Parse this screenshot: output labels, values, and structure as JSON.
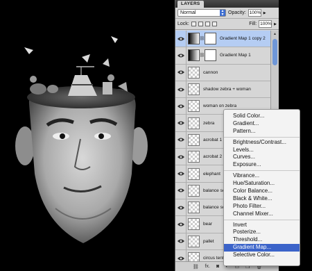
{
  "panel": {
    "tab": "LAYERS",
    "blend_mode": "Normal",
    "opacity_label": "Opacity:",
    "opacity_value": "100%",
    "lock_label": "Lock:",
    "fill_label": "Fill:",
    "fill_value": "100%"
  },
  "layers": [
    {
      "name": "Gradient Map 1 copy 2",
      "type": "adjustment",
      "selected": true
    },
    {
      "name": "Gradient Map 1",
      "type": "adjustment",
      "selected": false
    },
    {
      "name": "cannon",
      "type": "pixel",
      "selected": false
    },
    {
      "name": "shadow zebra + woman",
      "type": "pixel",
      "selected": false
    },
    {
      "name": "woman on zebra",
      "type": "pixel",
      "selected": false
    },
    {
      "name": "zebra",
      "type": "pixel",
      "selected": false
    },
    {
      "name": "acrobat 1",
      "type": "pixel",
      "selected": false
    },
    {
      "name": "acrobat 2",
      "type": "pixel",
      "selected": false
    },
    {
      "name": "elephant",
      "type": "pixel",
      "selected": false
    },
    {
      "name": "balance scale",
      "type": "pixel",
      "selected": false
    },
    {
      "name": "balance scale",
      "type": "pixel",
      "selected": false
    },
    {
      "name": "bear",
      "type": "pixel",
      "selected": false
    },
    {
      "name": "pallet",
      "type": "pixel",
      "selected": false
    },
    {
      "name": "circus tent",
      "type": "pixel",
      "selected": false
    }
  ],
  "menu": {
    "groups": [
      [
        "Solid Color...",
        "Gradient...",
        "Pattern..."
      ],
      [
        "Brightness/Contrast...",
        "Levels...",
        "Curves...",
        "Exposure..."
      ],
      [
        "Vibrance...",
        "Hue/Saturation...",
        "Color Balance...",
        "Black & White...",
        "Photo Filter...",
        "Channel Mixer..."
      ],
      [
        "Invert",
        "Posterize...",
        "Threshold...",
        "Gradient Map...",
        "Selective Color..."
      ]
    ],
    "highlighted": "Gradient Map...",
    "highlight_color": "#3b63c9"
  },
  "footer_icons": [
    "link-icon",
    "fx-icon",
    "mask-icon",
    "adjustment-icon",
    "folder-icon",
    "new-layer-icon",
    "trash-icon"
  ],
  "footer_fx_label": "fx."
}
